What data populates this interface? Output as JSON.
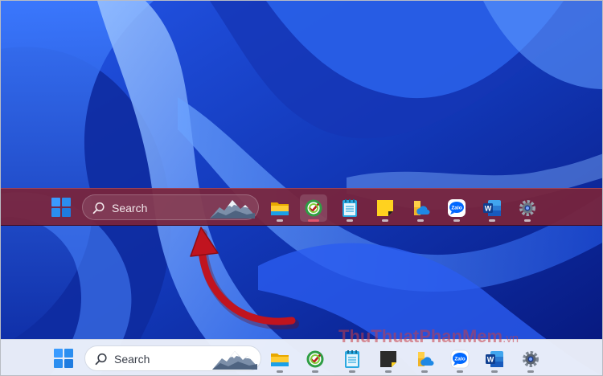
{
  "wallpaper": {
    "theme": "windows-11-bloom-blue",
    "colors": [
      "#0a1f7a",
      "#1f4fe6",
      "#4d86ff",
      "#9cc2ff"
    ]
  },
  "taskbar_highlight": {
    "background": "#7a243a",
    "search": {
      "placeholder": "Search",
      "decoration": "mountain-icon"
    },
    "apps": [
      {
        "name": "File Explorer",
        "icon": "folder-icon",
        "active": false
      },
      {
        "name": "CCleaner",
        "icon": "ccleaner-icon",
        "active": true
      },
      {
        "name": "Notepad",
        "icon": "notepad-icon",
        "active": false
      },
      {
        "name": "Sticky Notes",
        "icon": "sticky-notes-icon",
        "active": false
      },
      {
        "name": "OneDrive",
        "icon": "onedrive-icon",
        "active": false
      },
      {
        "name": "Zalo",
        "icon": "zalo-icon",
        "label": "Zalo",
        "active": false
      },
      {
        "name": "Word",
        "icon": "word-icon",
        "label": "W",
        "active": false
      },
      {
        "name": "Settings",
        "icon": "gear-icon",
        "active": false
      }
    ]
  },
  "taskbar_bottom": {
    "background": "#ecf1fa",
    "search": {
      "placeholder": "Search",
      "decoration": "mountain-icon"
    },
    "apps": [
      {
        "name": "File Explorer",
        "icon": "folder-icon",
        "active": false
      },
      {
        "name": "CCleaner",
        "icon": "ccleaner-icon",
        "active": false
      },
      {
        "name": "Notepad",
        "icon": "notepad-icon",
        "active": false
      },
      {
        "name": "Sticky Notes",
        "icon": "sticky-notes-icon",
        "active": false
      },
      {
        "name": "OneDrive",
        "icon": "onedrive-icon",
        "active": false
      },
      {
        "name": "Zalo",
        "icon": "zalo-icon",
        "label": "Zalo",
        "active": false
      },
      {
        "name": "Word",
        "icon": "word-icon",
        "label": "W",
        "active": false
      },
      {
        "name": "Settings",
        "icon": "gear-icon",
        "active": false
      }
    ]
  },
  "annotation": {
    "arrow_color": "#c0141f",
    "meaning": "move taskbar to center of screen"
  },
  "watermark": {
    "text": "ThuThuatPhanMem",
    "suffix": ".vn",
    "color": "#c83c46"
  },
  "colors": {
    "accent_blue": "#1a73e8",
    "start_blue": "#2b8ef0",
    "indicator_active": "#e2556b"
  }
}
